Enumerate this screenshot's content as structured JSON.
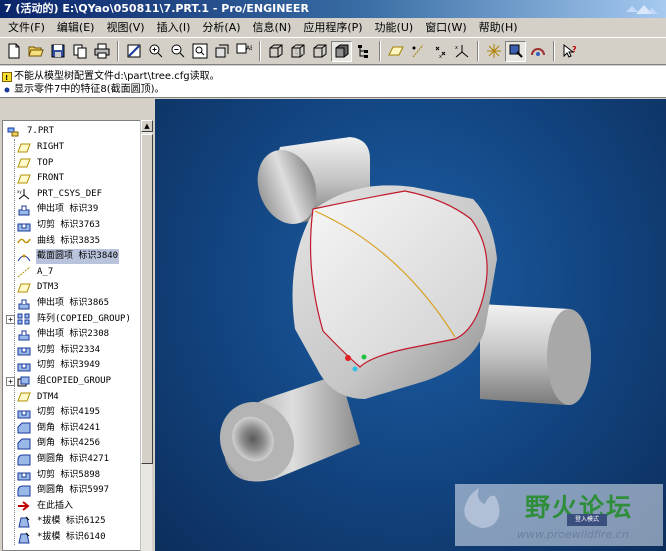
{
  "window": {
    "title": "7 (活动的) E:\\QYao\\050811\\7.PRT.1 - Pro/ENGINEER"
  },
  "menu": [
    "文件(F)",
    "编辑(E)",
    "视图(V)",
    "插入(I)",
    "分析(A)",
    "信息(N)",
    "应用程序(P)",
    "功能(U)",
    "窗口(W)",
    "帮助(H)"
  ],
  "messages": [
    "不能从模型树配置文件d:\\part\\tree.cfg读取。",
    "显示零件7中的特征8(截面圆顶)。"
  ],
  "tree": {
    "root": "7.PRT",
    "items": [
      {
        "label": "RIGHT",
        "icon": "datum-plane-icon"
      },
      {
        "label": "TOP",
        "icon": "datum-plane-icon"
      },
      {
        "label": "FRONT",
        "icon": "datum-plane-icon"
      },
      {
        "label": "PRT_CSYS_DEF",
        "icon": "csys-icon"
      },
      {
        "label": "伸出项 标识39",
        "icon": "protrusion-icon"
      },
      {
        "label": "切剪 标识3763",
        "icon": "cut-icon"
      },
      {
        "label": "曲线 标识3835",
        "icon": "curve-icon"
      },
      {
        "label": "截面圆项 标识3840",
        "icon": "dome-icon",
        "selected": true
      },
      {
        "label": "A_7",
        "icon": "axis-icon"
      },
      {
        "label": "DTM3",
        "icon": "datum-plane-icon"
      },
      {
        "label": "伸出项 标识3865",
        "icon": "protrusion-icon"
      },
      {
        "label": "阵列(COPIED_GROUP)",
        "icon": "pattern-icon",
        "expander": true
      },
      {
        "label": "伸出项 标识2308",
        "icon": "protrusion-icon"
      },
      {
        "label": "切剪 标识2334",
        "icon": "cut-icon"
      },
      {
        "label": "切剪 标识3949",
        "icon": "cut-icon"
      },
      {
        "label": "组COPIED_GROUP",
        "icon": "group-icon",
        "expander": true
      },
      {
        "label": "DTM4",
        "icon": "datum-plane-icon"
      },
      {
        "label": "切剪 标识4195",
        "icon": "cut-icon"
      },
      {
        "label": "倒角 标识4241",
        "icon": "chamfer-icon"
      },
      {
        "label": "倒角 标识4256",
        "icon": "chamfer-icon"
      },
      {
        "label": "倒圆角 标识4271",
        "icon": "round-icon"
      },
      {
        "label": "切剪 标识5898",
        "icon": "cut-icon"
      },
      {
        "label": "倒圆角 标识5997",
        "icon": "round-icon"
      },
      {
        "label": "在此插入",
        "icon": "insert-here-icon"
      },
      {
        "label": "*拔模 标识6125",
        "icon": "draft-icon"
      },
      {
        "label": "*拔模 标识6140",
        "icon": "draft-icon"
      }
    ]
  },
  "watermark": {
    "title": "野火论坛",
    "badge": "登入模式",
    "url": "www.proewildfire.cn"
  },
  "colors": {
    "viewport_bg": "#12437e",
    "selection": "#b9c4dc",
    "datum_plane": "#c8a400",
    "edge_red": "#c0182a",
    "curve_yellow": "#d8a020"
  }
}
